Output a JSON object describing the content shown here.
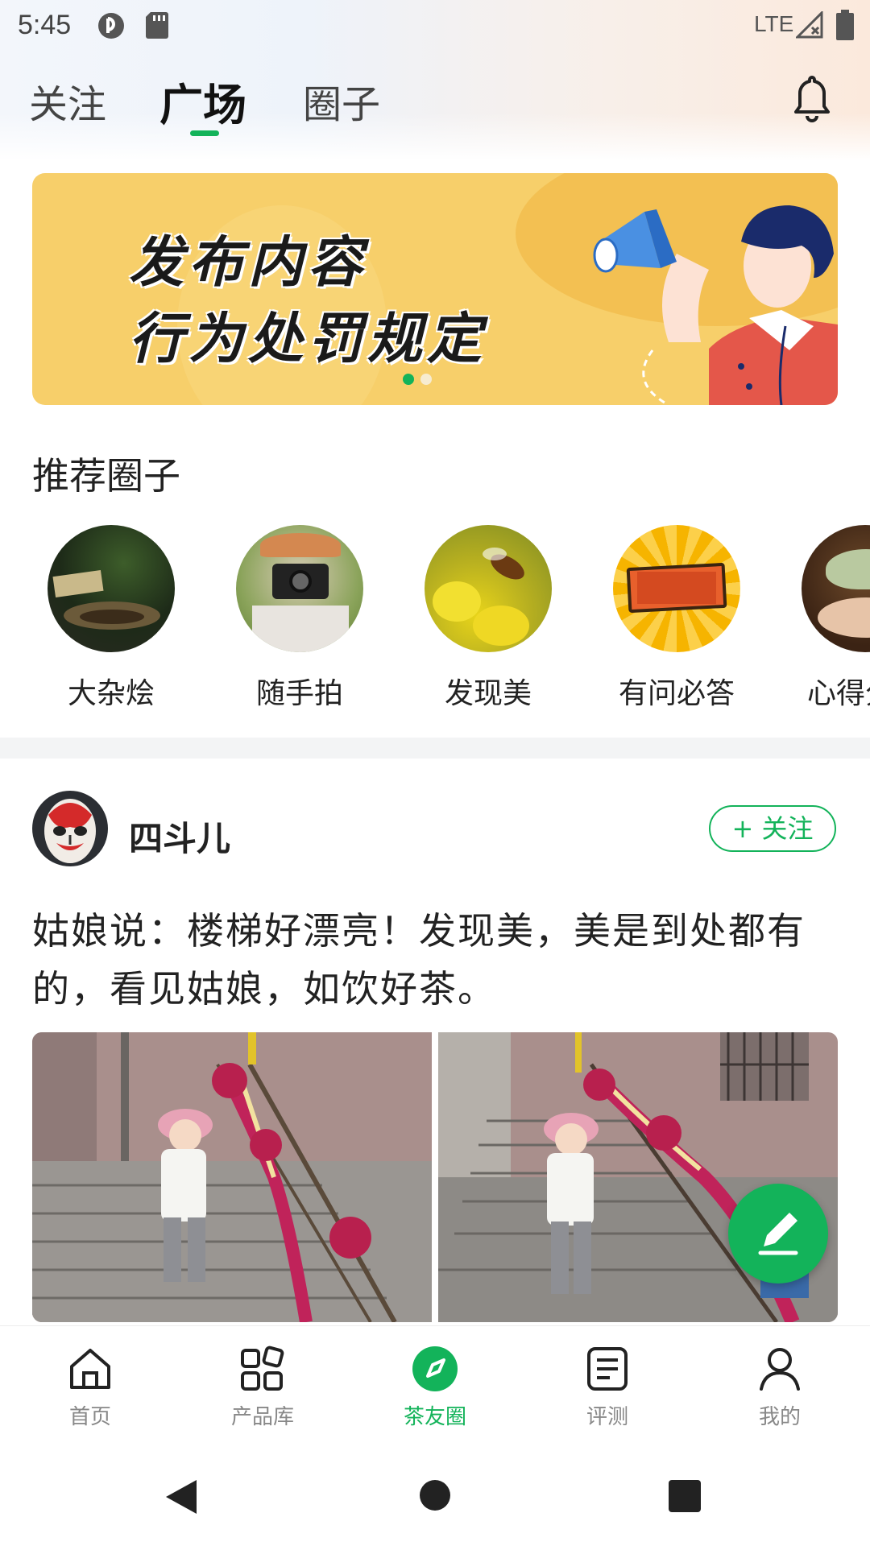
{
  "status_bar": {
    "time": "5:45",
    "network": "LTE"
  },
  "top_tabs": [
    {
      "label": "关注",
      "active": false
    },
    {
      "label": "广场",
      "active": true
    },
    {
      "label": "圈子",
      "active": false
    }
  ],
  "banner": {
    "line1": "发布内容",
    "line2": "行为处罚规定",
    "pages": 2,
    "current_page": 1
  },
  "recommended": {
    "title": "推荐圈子",
    "circles": [
      {
        "label": "大杂烩",
        "icon": "tea-set-photo"
      },
      {
        "label": "随手拍",
        "icon": "camera-photographer-photo"
      },
      {
        "label": "发现美",
        "icon": "bee-flower-photo"
      },
      {
        "label": "有问必答",
        "icon": "qa-badge-icon"
      },
      {
        "label": "心得分享",
        "icon": "tea-cup-photo"
      }
    ]
  },
  "post": {
    "username": "四斗儿",
    "follow_label": "+ 关注",
    "text": "姑娘说：楼梯好漂亮！发现美，美是到处都有的，看见姑娘，如饮好茶。"
  },
  "bottom_nav": [
    {
      "label": "首页",
      "icon": "home-icon",
      "active": false
    },
    {
      "label": "产品库",
      "icon": "grid-icon",
      "active": false
    },
    {
      "label": "茶友圈",
      "icon": "compass-icon",
      "active": true
    },
    {
      "label": "评测",
      "icon": "notes-icon",
      "active": false
    },
    {
      "label": "我的",
      "icon": "profile-icon",
      "active": false
    }
  ],
  "colors": {
    "accent": "#13b35a",
    "banner_bg": "#f7cf6a"
  }
}
